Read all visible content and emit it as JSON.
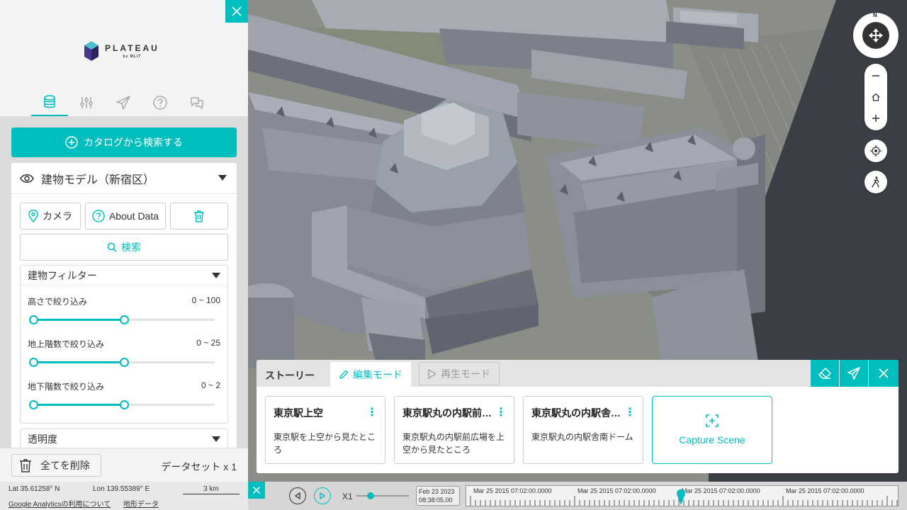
{
  "panel": {
    "brand_name": "PLATEAU",
    "brand_sub": "by MLIT",
    "tabs": [
      "database-icon",
      "sliders-icon",
      "send-icon",
      "help-icon",
      "chat-icon"
    ],
    "catalog_button": "カタログから検索する",
    "layer": {
      "title": "建物モデル（新宿区）",
      "camera_label": "カメラ",
      "about_label": "About Data",
      "search_label": "検索",
      "filter_title": "建物フィルター",
      "filters": [
        {
          "label": "高さで絞り込み",
          "range": "0 ~ 100",
          "fill": 0.5
        },
        {
          "label": "地上階数で絞り込み",
          "range": "0 ~ 25",
          "fill": 0.5
        },
        {
          "label": "地下階数で絞り込み",
          "range": "0 ~ 2",
          "fill": 0.5
        }
      ],
      "opacity_title": "透明度"
    },
    "delete_all": "全てを削除",
    "dataset_count": "データセット x 1"
  },
  "status": {
    "lat": "Lat  35.61258° N",
    "lon": "Lon  139.55389° E",
    "scale": "3 km",
    "ga_link": "Google Analyticsの利用について",
    "terrain_link": "地形データ"
  },
  "compass": {
    "north": "N"
  },
  "story": {
    "title": "ストーリー",
    "edit_tab": "編集モード",
    "play_tab": "再生モード",
    "scenes": [
      {
        "title": "東京駅上空",
        "desc": "東京駅を上空から見たところ"
      },
      {
        "title": "東京駅丸の内駅前広場",
        "desc": "東京駅丸の内駅前広場を上空から見たところ"
      },
      {
        "title": "東京駅丸の内駅舎南ドーム",
        "desc": "東京駅丸の内駅舎南ドーム"
      }
    ],
    "capture_label": "Capture Scene"
  },
  "timeline": {
    "speed": "X1",
    "date_line1": "Feb 23 2023",
    "date_line2": "08:38:05.00",
    "labels": [
      "Mar 25 2015 07:02:00.0000",
      "Mar 25 2015 07:02:00.0000",
      "Mar 25 2015 07:02:00.0000",
      "Mar 25 2015 07:02:00.0000"
    ]
  },
  "colors": {
    "accent": "#00bebe",
    "building": "#8e939d"
  }
}
